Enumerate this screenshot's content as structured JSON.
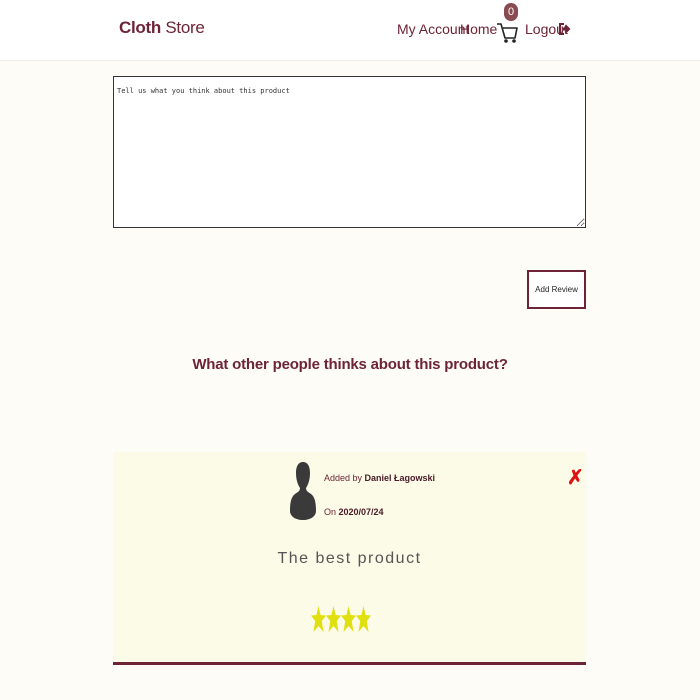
{
  "navbar": {
    "brand_bold": "Cloth",
    "brand_light": " Store",
    "my_account": "My Account",
    "home": "Home",
    "cart_count": "0",
    "logout": "Logout",
    "accent_color": "#6d2436"
  },
  "review_form": {
    "placeholder": "Tell us what you think about this product",
    "value": "",
    "submit_label": "Add Review"
  },
  "reviews_section": {
    "title": "What other people thinks about this product?",
    "reviews": [
      {
        "added_by_label": "Added by ",
        "author": "Daniel Łagowski",
        "on_label": "On ",
        "date": "2020/07/24",
        "text": "The best product",
        "rating": 4,
        "rating_max": 4,
        "delete_icon": "close-x-icon",
        "star_color": "#e0e010"
      }
    ]
  }
}
